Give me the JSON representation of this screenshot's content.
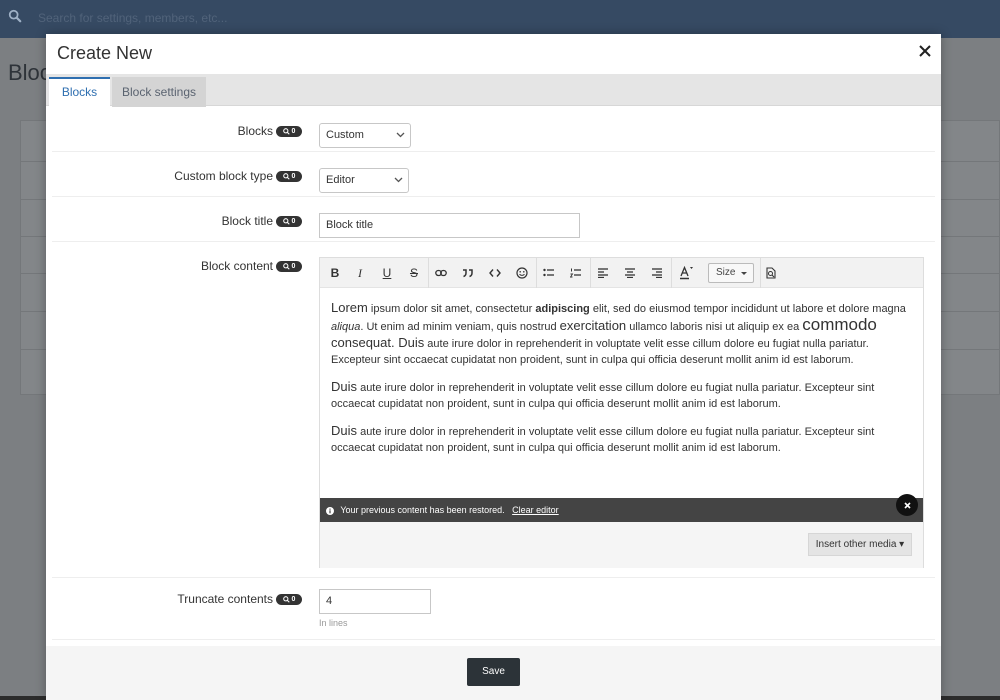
{
  "background": {
    "search_placeholder": "Search for settings, members, etc...",
    "page_title": "Bloc"
  },
  "modal": {
    "title": "Create New",
    "tabs": [
      {
        "label": "Blocks",
        "active": true
      },
      {
        "label": "Block settings",
        "active": false
      }
    ],
    "badge_count": "0",
    "fields": {
      "blocks": {
        "label": "Blocks",
        "value": "Custom"
      },
      "custom_block_type": {
        "label": "Custom block type",
        "value": "Editor"
      },
      "block_title": {
        "label": "Block title",
        "value": "Block title"
      },
      "block_content": {
        "label": "Block content"
      },
      "truncate_contents": {
        "label": "Truncate contents",
        "value": "4",
        "hint": "In lines"
      }
    },
    "editor": {
      "toolbar": {
        "bold": "B",
        "italic": "I",
        "underline": "U",
        "strike": "S",
        "size_label": "Size"
      },
      "paragraph1": {
        "w1": "Lorem",
        "t1": " ipsum dolor sit amet, consectetur ",
        "w2": "adipiscing",
        "t2": " elit, sed do eiusmod tempor incididunt ut labore et dolore magna ",
        "w3": "aliqua",
        "t3": ". Ut enim ad minim veniam, quis nostrud ",
        "w4": "exercitation",
        "t4": " ullamco laboris nisi ut aliquip ex ea ",
        "w5": "commodo",
        "w6": "consequat",
        "t5": ". ",
        "w7": "Duis",
        "t6": " aute irure dolor in reprehenderit in voluptate velit esse cillum dolore eu fugiat nulla pariatur. Excepteur sint occaecat cupidatat non proident, sunt in culpa qui officia deserunt mollit anim id est laborum."
      },
      "paragraph2": {
        "w1": "Duis",
        "t1": " aute irure dolor in reprehenderit in voluptate velit esse cillum dolore eu fugiat nulla pariatur. Excepteur sint occaecat cupidatat non proident, sunt in culpa qui officia deserunt mollit anim id est laborum."
      },
      "paragraph3": {
        "w1": "Duis",
        "t1": " aute irure dolor in reprehenderit in voluptate velit esse cillum dolore eu fugiat nulla pariatur. Excepteur sint occaecat cupidatat non proident, sunt in culpa qui officia deserunt mollit anim id est laborum."
      },
      "restore_message": "Your previous content has been restored.",
      "clear_editor_label": "Clear editor",
      "insert_media_label": "Insert other media"
    },
    "save_label": "Save"
  }
}
